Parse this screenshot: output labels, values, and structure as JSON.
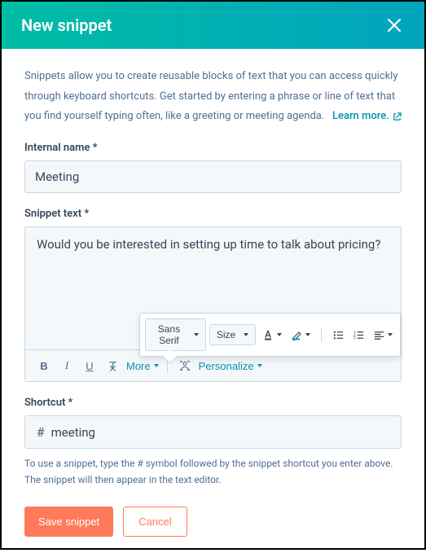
{
  "header": {
    "title": "New snippet"
  },
  "description": {
    "text": "Snippets allow you to create reusable blocks of text that you can access quickly through keyboard shortcuts. Get started by entering a phrase or line of text that you find yourself typing often, like a greeting or meeting agenda.",
    "learn_more": "Learn more."
  },
  "fields": {
    "internal_name": {
      "label": "Internal name *",
      "value": "Meeting"
    },
    "snippet_text": {
      "label": "Snippet text *",
      "value": "Would you be interested in setting up time to talk about pricing?"
    },
    "shortcut": {
      "label": "Shortcut *",
      "prefix": "#",
      "value": "meeting",
      "helper": "To use a snippet, type the # symbol followed by the snippet shortcut you enter above. The snippet will then appear in the text editor."
    }
  },
  "toolbar": {
    "more": "More",
    "personalize": "Personalize",
    "font_family": "Sans Serif",
    "size": "Size"
  },
  "actions": {
    "save": "Save snippet",
    "cancel": "Cancel"
  },
  "colors": {
    "accent": "#ff7a59",
    "link": "#0091ae",
    "header_gradient_start": "#00bda5",
    "header_gradient_end": "#00a4bd"
  }
}
